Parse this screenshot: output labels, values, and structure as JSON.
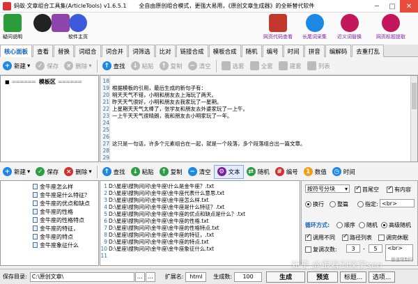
{
  "window": {
    "title": "蚂蚁·文章组合工具集(ArticleTools) v1.6.5.1",
    "slogan": "全自由原创组合模式，更强大易用，《原创文章生成器》的全新替代软件"
  },
  "ribbon": [
    {
      "label": "疑问说明",
      "color": "#2a9d3a"
    },
    {
      "label": "",
      "color": "#1e88e5"
    },
    {
      "label": "",
      "color": "#8e44ad"
    },
    {
      "label": "软件主页",
      "color": "#3b5bdb"
    },
    {
      "label": "网页代码查看",
      "color": "#c0392b"
    },
    {
      "label": "长尾词采集",
      "color": "#1e88e5"
    },
    {
      "label": "近义词替换",
      "color": "#c2185b"
    },
    {
      "label": "网页标题提取",
      "color": "#c2185b"
    }
  ],
  "tabs": [
    "核心面板",
    "查看",
    "替换",
    "词组合",
    "词合并",
    "词筛选",
    "比对",
    "链接合成",
    "模板合成",
    "随机",
    "编号",
    "时间",
    "拼音",
    "编解码",
    "去重打乱"
  ],
  "toolbar_top": {
    "new": "新建",
    "save": "保存",
    "delete": "删除",
    "find": "查找",
    "paste": "粘贴",
    "copy": "复制",
    "clear": "清空",
    "select": "选套",
    "all": "全套",
    "build": "建套",
    "list": "列表"
  },
  "tree": {
    "label": "模板区"
  },
  "editor": {
    "lines": [
      {
        "n": "18",
        "t": ""
      },
      {
        "n": "19",
        "t": "根据模板的引用，最后生成的新句子有："
      },
      {
        "n": "20",
        "t": "明天天气不错，小明和朋友去上海玩了两天。"
      },
      {
        "n": "21",
        "t": "昨天天气很好，小明和朋友去我家玩了一星期。"
      },
      {
        "n": "22",
        "t": "上星期天天气太棒了，张学友和朋友去外婆家玩了一上午。"
      },
      {
        "n": "23",
        "t": "一上午天天气很晴朗，我和朋友去小明家玩了一年。"
      },
      {
        "n": "24",
        "t": ""
      },
      {
        "n": "25",
        "t": ""
      },
      {
        "n": "26",
        "t": ""
      },
      {
        "n": "27",
        "t": "这只是一句话，许多个元素组合在一起，就是一个段落，多个段落组合出一篇文章。"
      },
      {
        "n": "28",
        "t": ""
      },
      {
        "n": "29",
        "t": ""
      }
    ]
  },
  "toolbar_bottom": {
    "new": "新建",
    "save": "保存",
    "delete": "删除",
    "find": "查找",
    "paste": "粘贴",
    "copy": "复制",
    "clear": "清空",
    "text": "文本",
    "random": "随机",
    "number": "编号",
    "value": "数值",
    "time": "时间"
  },
  "left_list": [
    "金牛座怎么样",
    "金牛座是什么特征？",
    "金牛座的优点和缺点",
    "金牛座的性格",
    "金牛座的性格特点",
    "金牛座的特征，",
    "金牛座的特点",
    "金牛座象征什么"
  ],
  "path_list": [
    {
      "n": "1",
      "t": "D:\\星座\\搜狗问问\\金牛座\\什么是金牛座？.txt"
    },
    {
      "n": "2",
      "t": "D:\\星座\\搜狗问问\\金牛座\\金牛座代表什么意思.txt"
    },
    {
      "n": "3",
      "t": "D:\\星座\\搜狗问问\\金牛座\\金牛座怎么样.txt"
    },
    {
      "n": "4",
      "t": "D:\\星座\\搜狗问问\\金牛座\\金牛座是什么特征？.txt"
    },
    {
      "n": "5",
      "t": "D:\\星座\\搜狗问问\\金牛座\\金牛座的优点和缺点是什么？.txt"
    },
    {
      "n": "6",
      "t": "D:\\星座\\搜狗问问\\金牛座\\金牛座的性格.txt"
    },
    {
      "n": "7",
      "t": "D:\\星座\\搜狗问问\\金牛座\\金牛座的性格特点.txt"
    },
    {
      "n": "8",
      "t": "D:\\星座\\搜狗问问\\金牛座\\金牛座的特征，.txt"
    },
    {
      "n": "9",
      "t": "D:\\星座\\搜狗问问\\金牛座\\金牛座的特点.txt"
    },
    {
      "n": "10",
      "t": "D:\\星座\\搜狗问问\\金牛座\\金牛座象征什么.txt"
    },
    {
      "n": "11",
      "t": ""
    }
  ],
  "options": {
    "split": "按符号分块",
    "first_blank": "首尾空",
    "has_content": "有内容",
    "wrap": "换行",
    "tidy": "整篇",
    "specify": "指定:",
    "specify_value": "<br>",
    "loop": "循环方式:",
    "seq": "顺序",
    "rand": "随机",
    "hq_rand": "高级随机",
    "diff": "调用不同",
    "path": "路径列表",
    "rest": "调完休眠",
    "repeat": "复调次数:",
    "r_from": "3",
    "r_dash": "-",
    "r_to": "5",
    "r_br": "<br>",
    "r_note": "量值限制行"
  },
  "status": {
    "save_dir_label": "保存目录:",
    "save_dir": "C:\\原创文章\\",
    "ext_label": "扩展名:",
    "ext": "html",
    "count_label": "生成数:",
    "count": "100",
    "generate": "生成",
    "preview": "预览",
    "title": "标题...",
    "select": "选项..."
  },
  "watermark": "知乎 @跟着剑侠学seo"
}
